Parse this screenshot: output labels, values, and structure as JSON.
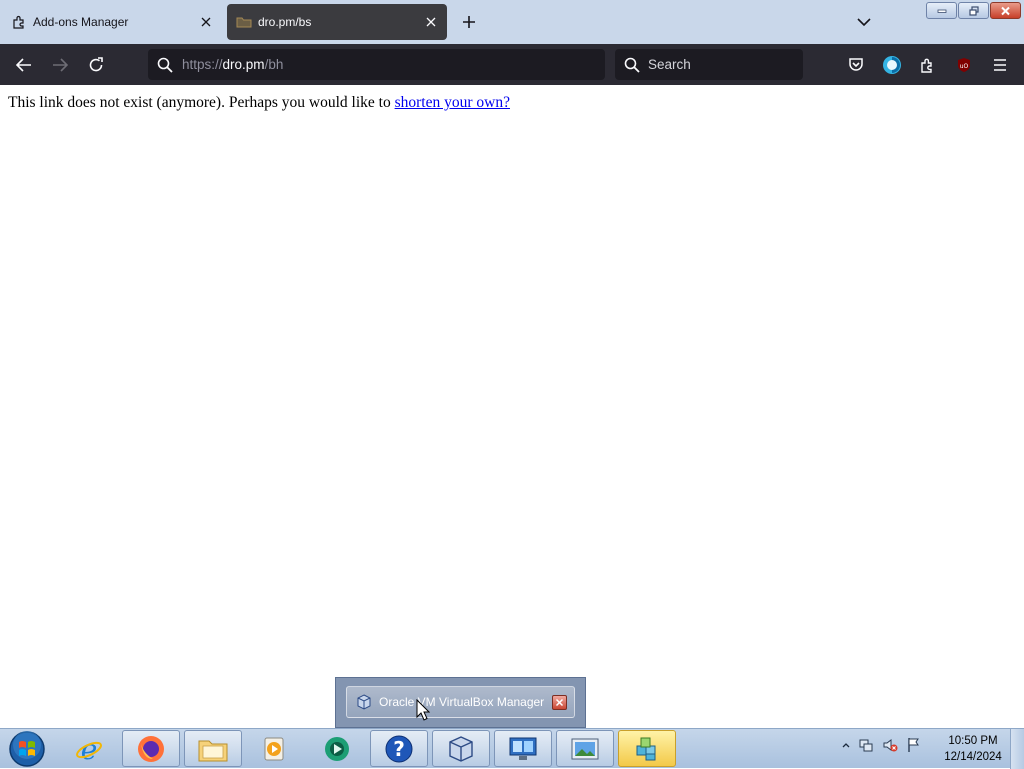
{
  "browser": {
    "tabs": [
      {
        "label": "Add-ons Manager",
        "icon": "puzzle-icon",
        "active": false
      },
      {
        "label": "dro.pm/bs",
        "icon": "folder-icon",
        "active": true
      }
    ],
    "url": {
      "scheme": "https://",
      "host": "dro.pm",
      "path": "/bh"
    },
    "search_placeholder": "Search",
    "toolbar_icons": [
      "pocket-icon",
      "account-icon",
      "extensions-icon",
      "ublock-icon",
      "menu-icon"
    ]
  },
  "page": {
    "message": "This link does not exist (anymore). Perhaps you would like to ",
    "link_text": "shorten your own?"
  },
  "taskbar": {
    "pinned": [
      "start-orb-icon",
      "internet-explorer-icon",
      "firefox-icon",
      "file-explorer-icon",
      "media-player-icon",
      "app-icon",
      "help-icon",
      "virtualbox-icon",
      "network-icon",
      "image-viewer-icon",
      "cube-app-icon"
    ],
    "clock": {
      "time": "10:50 PM",
      "date": "12/14/2024"
    }
  },
  "thumbnail": {
    "title": "Oracle VM VirtualBox Manager"
  },
  "colors": {
    "tabstrip": "#c9d7ea",
    "navbar": "#2b2a33",
    "urlbar": "#1c1b22",
    "link": "#0000ee"
  }
}
